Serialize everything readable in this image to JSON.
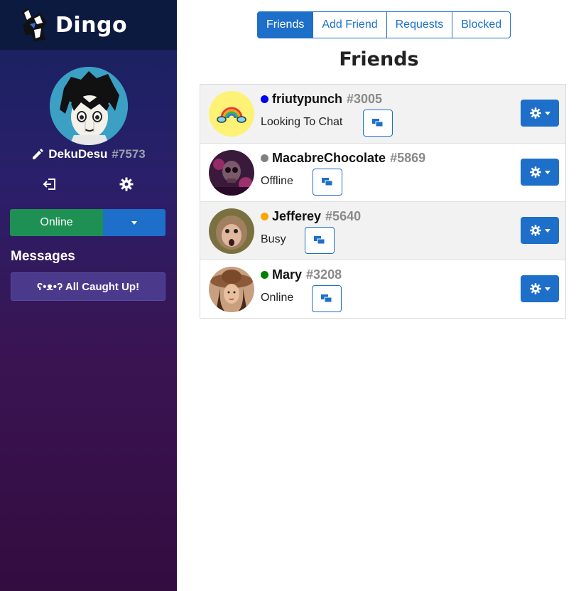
{
  "app": {
    "name": "Dingo"
  },
  "user": {
    "name": "DekuDesu",
    "discriminator": "#7573"
  },
  "status": {
    "label": "Online"
  },
  "messages": {
    "title": "Messages",
    "empty_label": "ʕ•ᴥ•ʔ All Caught Up!"
  },
  "tabs": [
    {
      "label": "Friends",
      "active": true
    },
    {
      "label": "Add Friend",
      "active": false
    },
    {
      "label": "Requests",
      "active": false
    },
    {
      "label": "Blocked",
      "active": false
    }
  ],
  "page_title": "Friends",
  "friends": [
    {
      "name": "friutypunch",
      "discriminator": "#3005",
      "status": "Looking To Chat",
      "status_color": "#0000ee"
    },
    {
      "name": "MacabreChocolate",
      "discriminator": "#5869",
      "status": "Offline",
      "status_color": "#808080"
    },
    {
      "name": "Jefferey",
      "discriminator": "#5640",
      "status": "Busy",
      "status_color": "#ffa500"
    },
    {
      "name": "Mary",
      "discriminator": "#3208",
      "status": "Online",
      "status_color": "#008000"
    }
  ],
  "colors": {
    "primary": "#1d6fc9",
    "online_green": "#1e9054",
    "sidebar_top": "#0d1a40"
  }
}
